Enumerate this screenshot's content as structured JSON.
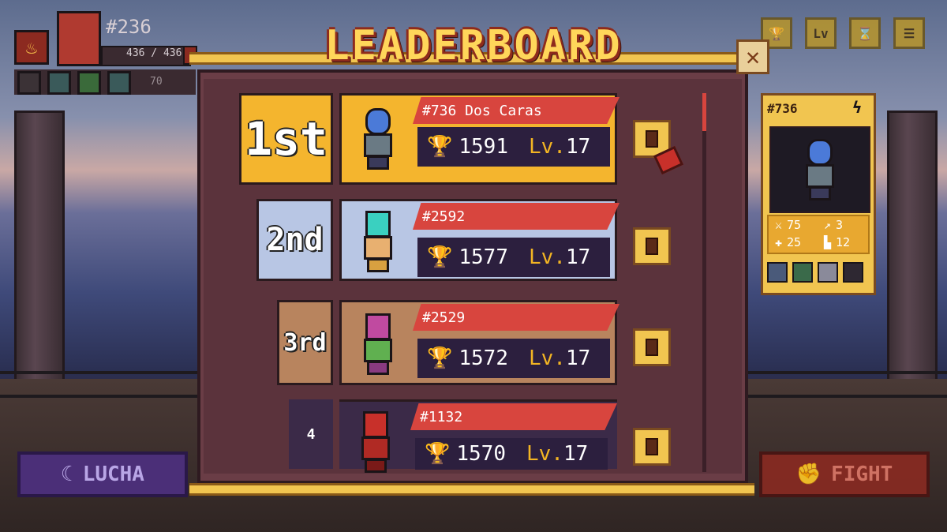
{
  "player": {
    "id": "#236",
    "health": "436 / 436",
    "extra_value": "70"
  },
  "top_right_buttons": [
    {
      "label": "",
      "icon": "trophy-icon"
    },
    {
      "label": "Lv",
      "icon": "level-icon"
    },
    {
      "label": "",
      "icon": "hourglass-icon"
    },
    {
      "label": "",
      "icon": "menu-icon"
    }
  ],
  "modal": {
    "title": "LEADERBOARD",
    "close_label": "✕"
  },
  "leaderboard": [
    {
      "rank": "1st",
      "id": "#736 Dos Caras",
      "trophies": "1591",
      "lv_label": "Lv.",
      "level": "17",
      "rank_color": "#f4b52e",
      "card_color": "#f4b52e"
    },
    {
      "rank": "2nd",
      "id": "#2592",
      "trophies": "1577",
      "lv_label": "Lv.",
      "level": "17",
      "rank_color": "#b8c6e4",
      "card_color": "#b8c6e4"
    },
    {
      "rank": "3rd",
      "id": "#2529",
      "trophies": "1572",
      "lv_label": "Lv.",
      "level": "17",
      "rank_color": "#b8845e",
      "card_color": "#b8845e"
    },
    {
      "rank": "4",
      "id": "#1132",
      "trophies": "1570",
      "lv_label": "Lv.",
      "level": "17",
      "rank_color": "#3b2a48",
      "card_color": "#3b2a48"
    }
  ],
  "selected_fighter": {
    "id": "#736",
    "attack": "75",
    "speed": "3",
    "health": "25",
    "defense": "12"
  },
  "buttons": {
    "lucha": "LUCHA",
    "fight": "FIGHT"
  }
}
